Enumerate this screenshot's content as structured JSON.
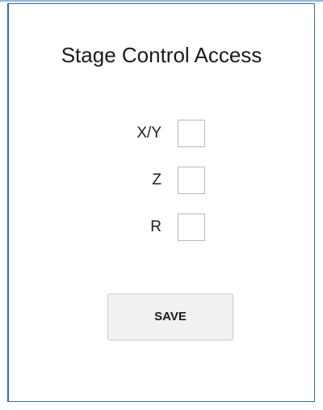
{
  "panel": {
    "title": "Stage Control Access",
    "axes": [
      {
        "label": "X/Y",
        "checked": false
      },
      {
        "label": "Z",
        "checked": false
      },
      {
        "label": "R",
        "checked": false
      }
    ],
    "save_label": "SAVE"
  },
  "colors": {
    "border_accent": "#2c6fb5",
    "checkbox_border": "#b9b9b9",
    "button_background": "#f1f1f1"
  }
}
